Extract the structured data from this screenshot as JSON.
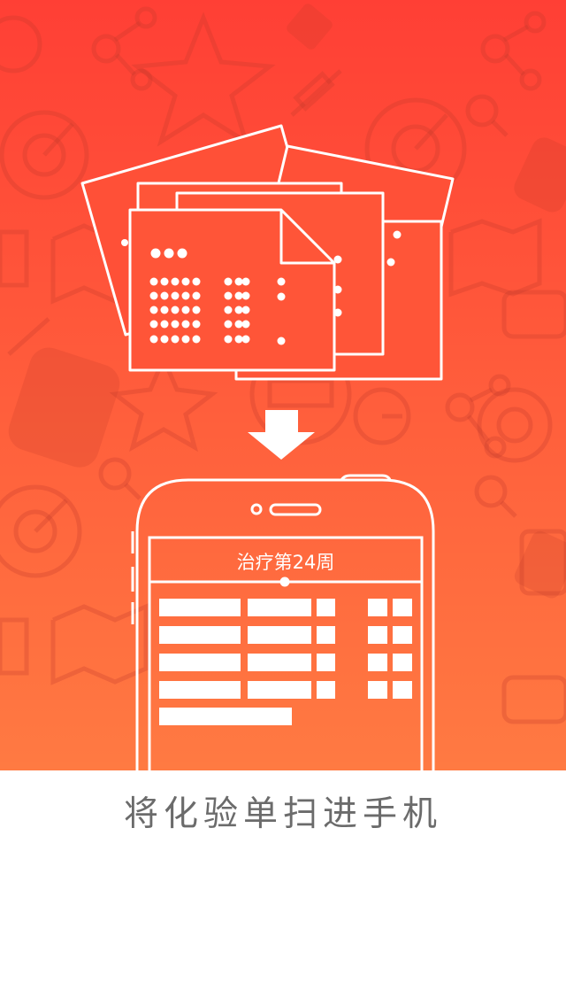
{
  "hero": {
    "gradient_top": "#ff3f35",
    "gradient_bottom": "#ff7a42",
    "phone_screen_title": "治疗第24周"
  },
  "caption": {
    "text": "将化验单扫进手机",
    "color": "#6b6b6b"
  },
  "icons": [
    "radar-icon",
    "star-icon",
    "syringe-icon",
    "molecule-icon",
    "map-icon",
    "search-icon",
    "clipboard-icon",
    "bandage-icon",
    "clock-icon",
    "pill-bottle-icon"
  ]
}
